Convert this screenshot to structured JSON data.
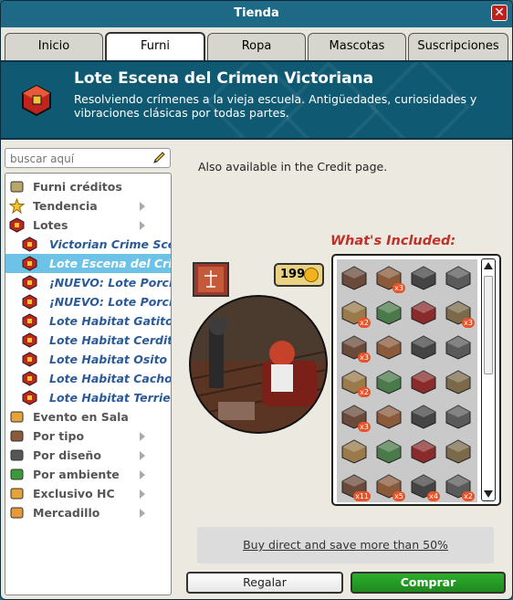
{
  "window": {
    "title": "Tienda",
    "close_label": "✕"
  },
  "tabs": [
    {
      "label": "Inicio"
    },
    {
      "label": "Furni"
    },
    {
      "label": "Ropa"
    },
    {
      "label": "Mascotas"
    },
    {
      "label": "Suscripciones"
    }
  ],
  "banner": {
    "title": "Lote Escena del Crimen Victoriana",
    "description": "Resolviendo crímenes a la vieja escuela. Antigüedades, curiosidades y vibraciones clásicas por todas partes."
  },
  "search": {
    "placeholder": "buscar aquí"
  },
  "sidebar": {
    "items": [
      {
        "label": "Furni créditos",
        "icon": "credits-icon",
        "level": 0,
        "expandable": false
      },
      {
        "label": "Tendencia",
        "icon": "star-icon",
        "level": 0,
        "expandable": true
      },
      {
        "label": "Lotes",
        "icon": "bundle-icon",
        "level": 0,
        "expandable": true
      },
      {
        "label": "Victorian Crime Scene Bu",
        "icon": "bundle-icon",
        "level": 1
      },
      {
        "label": "Lote Escena del Crimen V",
        "icon": "bundle-icon",
        "level": 1,
        "selected": true
      },
      {
        "label": "¡NUEVO: Lote Porche Mi",
        "icon": "bundle-icon",
        "level": 1
      },
      {
        "label": "¡NUEVO: Lote Porche Mi",
        "icon": "bundle-icon",
        "level": 1
      },
      {
        "label": "Lote Habitat Gatito",
        "icon": "bundle-icon",
        "level": 1
      },
      {
        "label": "Lote Habitat Cerdito",
        "icon": "bundle-icon",
        "level": 1
      },
      {
        "label": "Lote Habitat Osito Pola",
        "icon": "bundle-icon",
        "level": 1
      },
      {
        "label": "Lote Habitat Cachorro",
        "icon": "bundle-icon",
        "level": 1
      },
      {
        "label": "Lote Habitat Terrier",
        "icon": "bundle-icon",
        "level": 1
      },
      {
        "label": "Evento en Sala",
        "icon": "event-icon",
        "level": 0,
        "expandable": false
      },
      {
        "label": "Por tipo",
        "icon": "chair-icon",
        "level": 0,
        "expandable": true
      },
      {
        "label": "Por diseño",
        "icon": "column-icon",
        "level": 0,
        "expandable": true
      },
      {
        "label": "Por ambiente",
        "icon": "plant-icon",
        "level": 0,
        "expandable": true
      },
      {
        "label": "Exclusivo HC",
        "icon": "hc-icon",
        "level": 0,
        "expandable": true
      },
      {
        "label": "Mercadillo",
        "icon": "market-icon",
        "level": 0,
        "expandable": true
      }
    ]
  },
  "main": {
    "info": "Also available in the Credit page.",
    "price": "199",
    "whats_included": "What's Included:",
    "items": [
      {
        "icon": "lamp-icon",
        "badge": ""
      },
      {
        "icon": "chair-icon",
        "badge": "x3"
      },
      {
        "icon": "typewriter-icon",
        "badge": ""
      },
      {
        "icon": "frame-icon",
        "badge": ""
      },
      {
        "icon": "crate-icon",
        "badge": "x2"
      },
      {
        "icon": "plant-icon",
        "badge": ""
      },
      {
        "icon": "flower-icon",
        "badge": ""
      },
      {
        "icon": "table-icon",
        "badge": "x3"
      },
      {
        "icon": "basket-icon",
        "badge": "x3"
      },
      {
        "icon": "chair-icon",
        "badge": ""
      },
      {
        "icon": "candle-icon",
        "badge": ""
      },
      {
        "icon": "papers-icon",
        "badge": ""
      },
      {
        "icon": "shelf-icon",
        "badge": "x2"
      },
      {
        "icon": "basket-icon",
        "badge": ""
      },
      {
        "icon": "money-icon",
        "badge": ""
      },
      {
        "icon": "cursor-icon",
        "badge": ""
      },
      {
        "icon": "sack-icon",
        "badge": "x3"
      },
      {
        "icon": "door-icon",
        "badge": ""
      },
      {
        "icon": "safe-icon",
        "badge": ""
      },
      {
        "icon": "clock-icon",
        "badge": ""
      },
      {
        "icon": "cage-icon",
        "badge": ""
      },
      {
        "icon": "door-icon",
        "badge": ""
      },
      {
        "icon": "pouf-icon",
        "badge": ""
      },
      {
        "icon": "chalk-icon",
        "badge": ""
      },
      {
        "icon": "bench-icon",
        "badge": "x11"
      },
      {
        "icon": "books-icon",
        "badge": "x5"
      },
      {
        "icon": "armchair-icon",
        "badge": "x4"
      },
      {
        "icon": "table-icon",
        "badge": "x2"
      }
    ],
    "save_link": "Buy direct and save more than 50%"
  },
  "buttons": {
    "gift": "Regalar",
    "buy": "Comprar"
  },
  "colors": {
    "accent": "#1e6986",
    "buy": "#1d8a1d",
    "selection": "#6cc3e7",
    "badge": "#e8542a",
    "title_red": "#c0302a"
  }
}
